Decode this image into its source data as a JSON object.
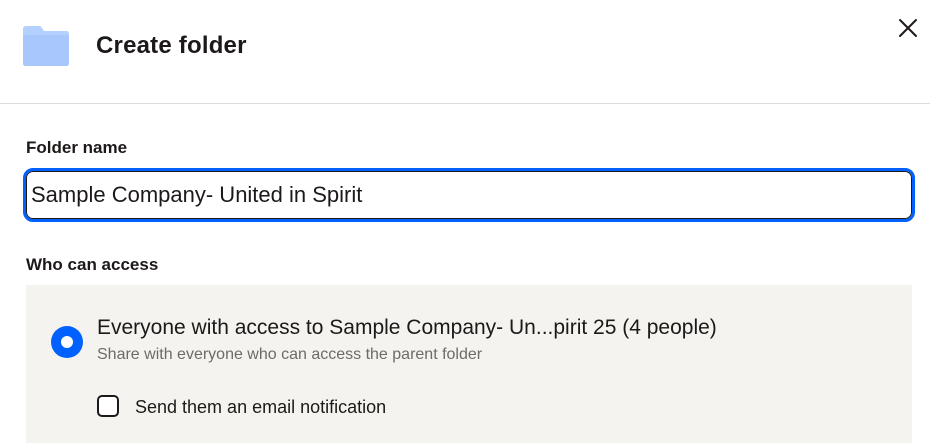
{
  "dialog": {
    "title": "Create folder",
    "icons": {
      "folder": "folder-icon",
      "close": "close-icon"
    }
  },
  "form": {
    "folder_name_label": "Folder name",
    "folder_name_value": "Sample Company- United in Spirit",
    "who_can_access_label": "Who can access"
  },
  "access": {
    "option_title": "Everyone with access to Sample Company- Un...pirit 25 (4 people)",
    "option_subtitle": "Share with everyone who can access the parent folder",
    "option_selected": true,
    "email_notification_label": "Send them an email notification",
    "email_notification_checked": false
  },
  "colors": {
    "accent": "#0061fe",
    "folder": "#b4d0fe",
    "panel_bg": "#f5f3f0",
    "text": "#1e1919",
    "muted_text": "#6e6a66"
  }
}
